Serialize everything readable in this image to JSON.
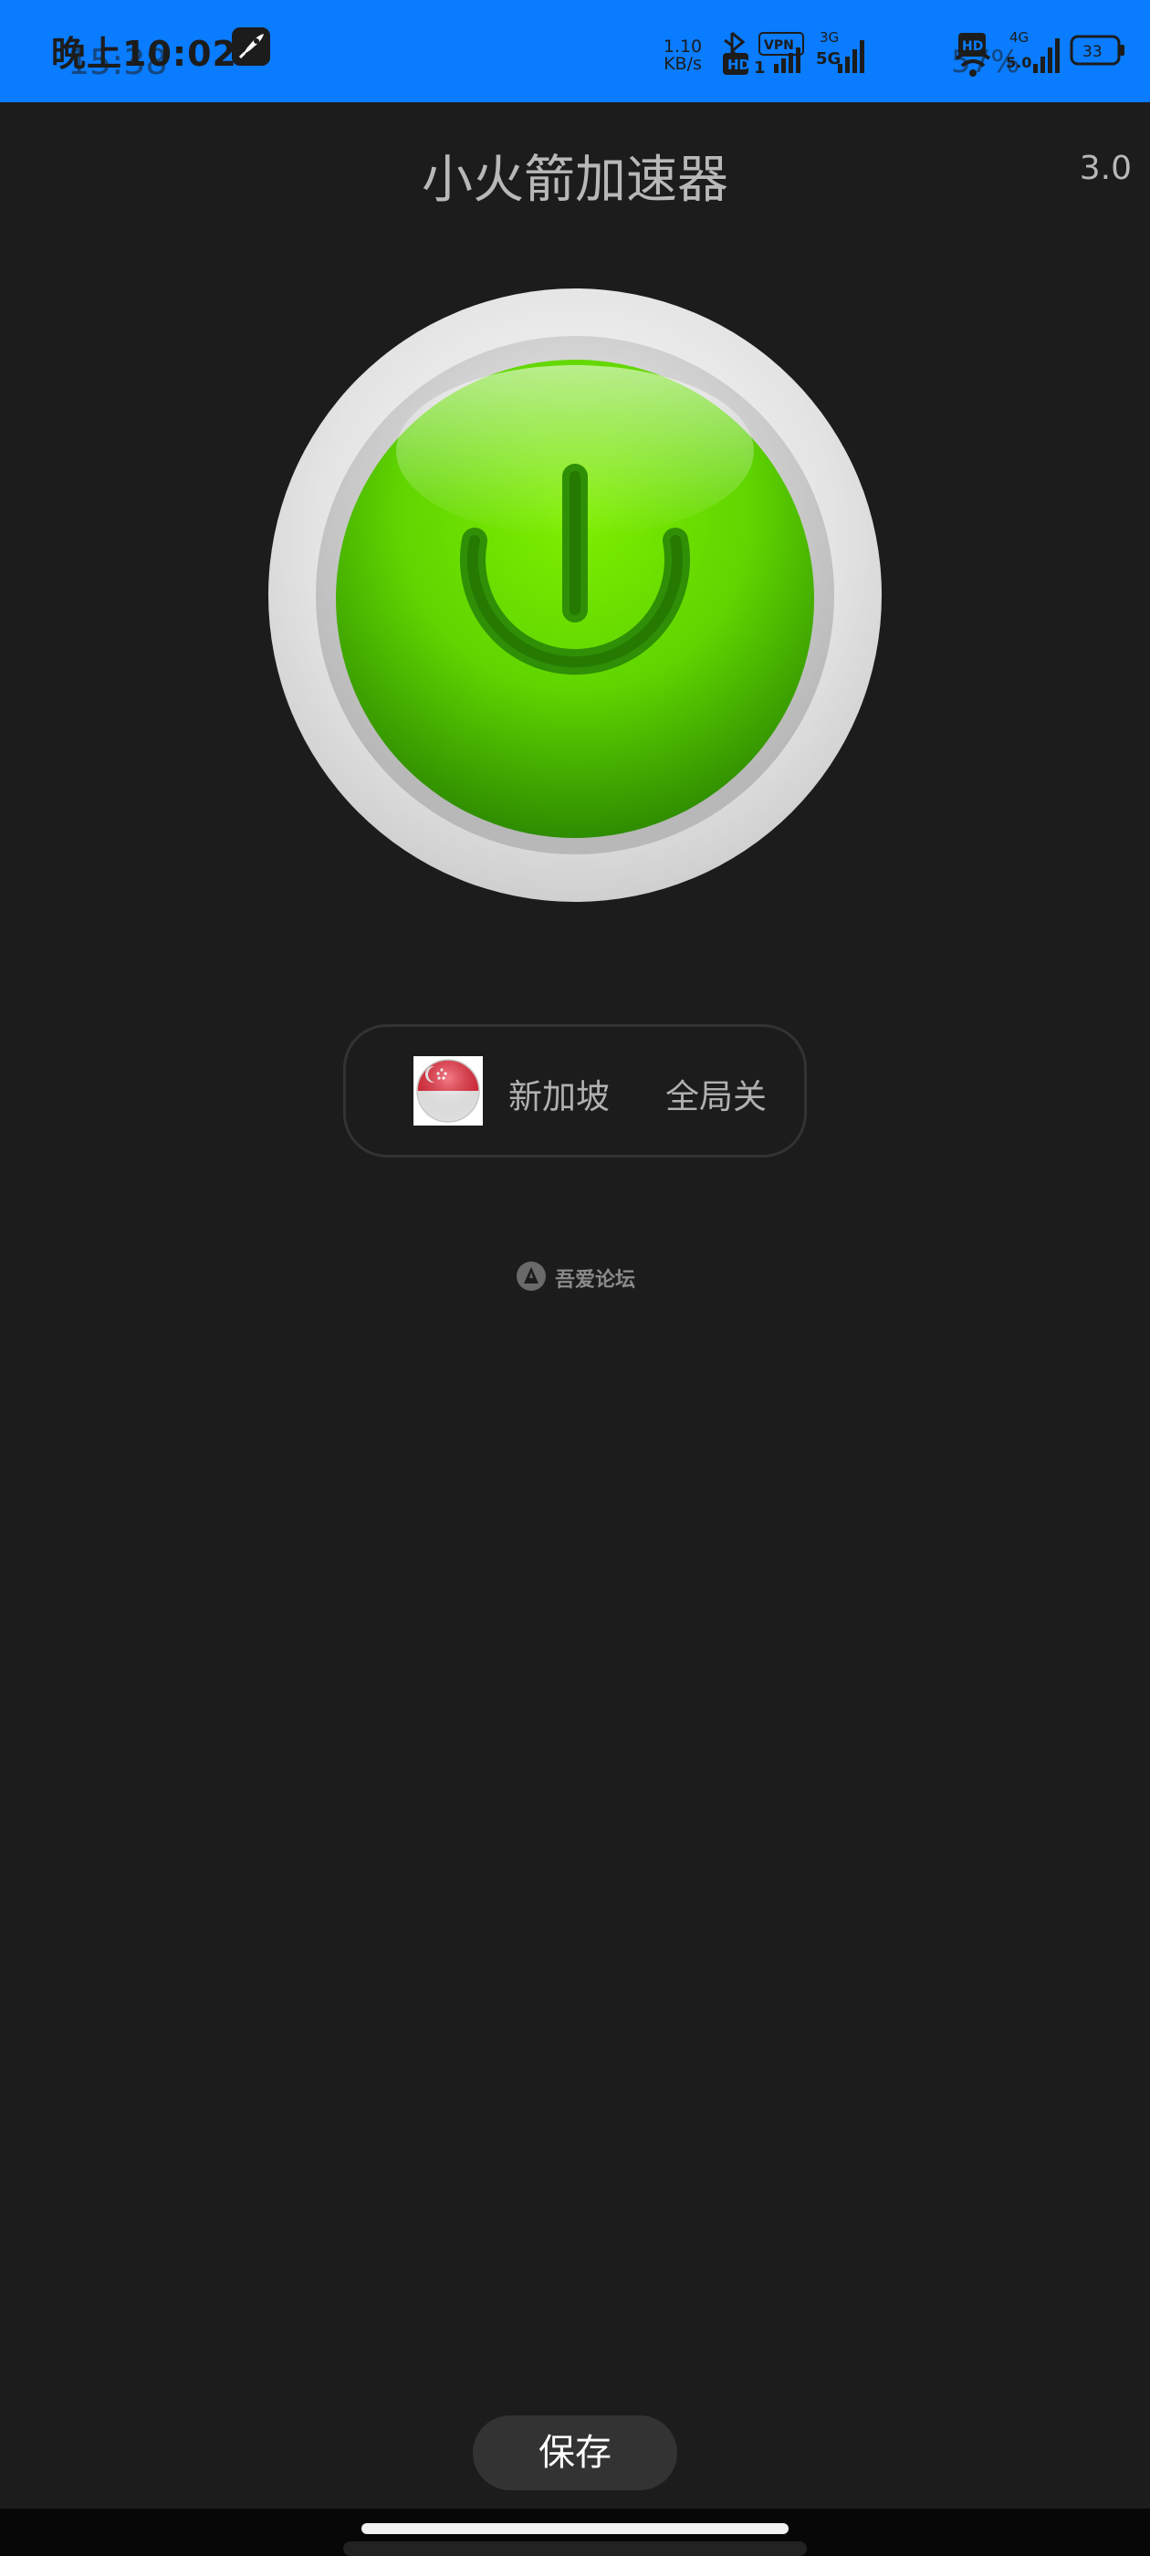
{
  "status_bar": {
    "time": "晚上10:02",
    "time_ghost": "15:38",
    "net_speed_value": "1.10",
    "net_speed_unit": "KB/s",
    "battery_level": "33",
    "status_text_ghost": "57%",
    "icons": [
      "rocket-app-icon",
      "bluetooth-icon",
      "hd-icon",
      "vpn-icon",
      "signal-3g-icon",
      "signal-5g-icon",
      "hd-icon",
      "wifi-icon",
      "signal-4g-icon",
      "battery-icon"
    ]
  },
  "header": {
    "title": "小火箭加速器",
    "version": "3.0"
  },
  "power": {
    "icon": "power-icon",
    "state": "on"
  },
  "mode": {
    "region_icon": "singapore-flag-icon",
    "region": "新加坡",
    "global_mode": "全局关"
  },
  "watermark": {
    "text": "吾爱论坛"
  },
  "footer": {
    "save_label": "保存"
  },
  "colors": {
    "status_bar": "#0a7cff",
    "background": "#1c1c1c",
    "power_green": "#5fd400",
    "text_muted": "#b8b8b8"
  }
}
